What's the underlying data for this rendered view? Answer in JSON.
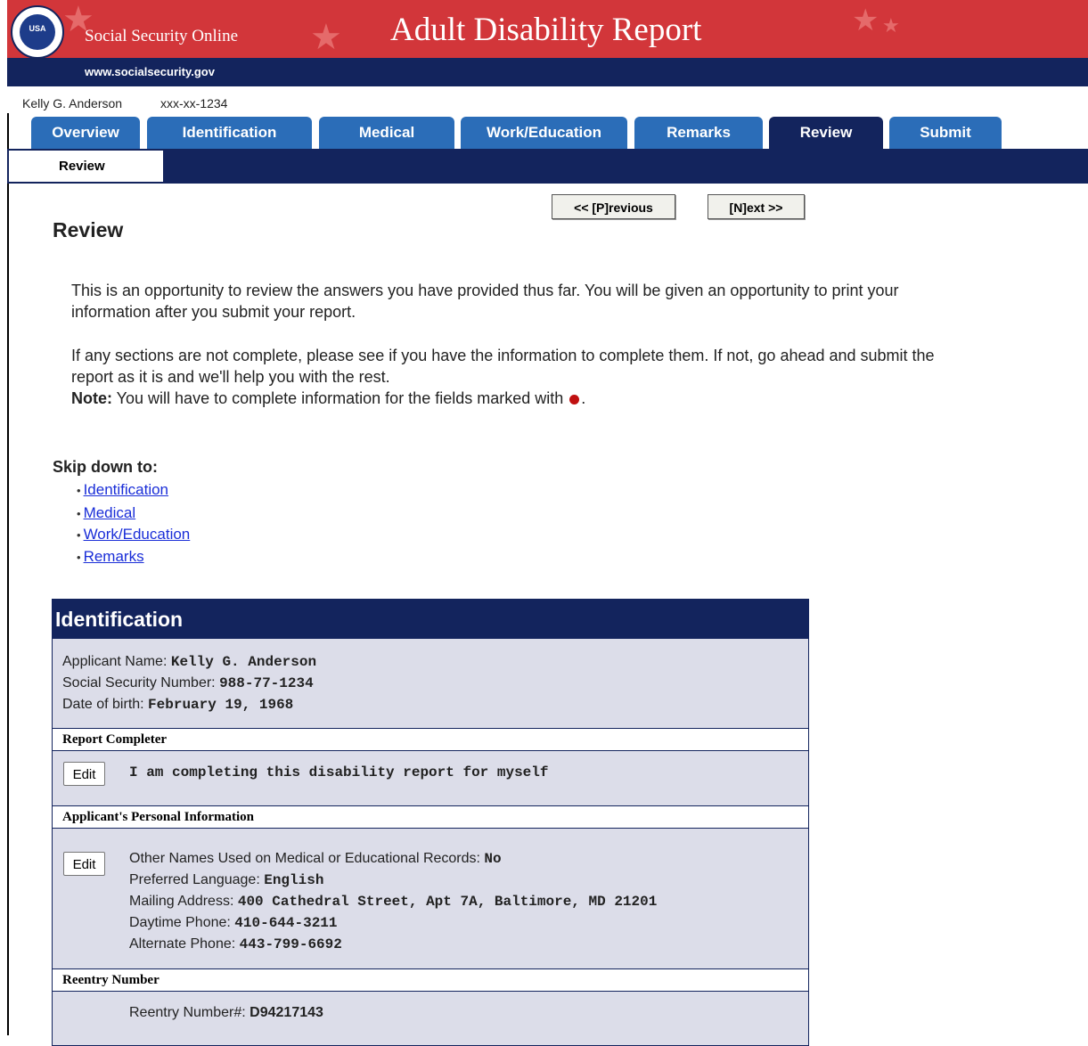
{
  "banner": {
    "seal_text": "USA",
    "brand": "Social Security Online",
    "site": "www.socialsecurity.gov",
    "title": "Adult Disability Report"
  },
  "user": {
    "name": "Kelly G. Anderson",
    "ssn": "xxx-xx-1234"
  },
  "tabs": [
    {
      "label": "Overview"
    },
    {
      "label": "Identification"
    },
    {
      "label": "Medical"
    },
    {
      "label": "Work/Education"
    },
    {
      "label": "Remarks"
    },
    {
      "label": "Review"
    },
    {
      "label": "Submit"
    }
  ],
  "active_tab": "Review",
  "subnav": {
    "active": "Review"
  },
  "nav": {
    "previous": "<< [P]revious",
    "next": "[N]ext >>"
  },
  "page": {
    "heading": "Review",
    "intro1": "This is an opportunity to review the answers you have provided thus far. You will be given an opportunity to print your information after you submit your report.",
    "intro2": "If any sections are not complete, please see if you have the information to complete them. If not, go ahead and submit the report as it is and we'll help you with the rest.",
    "note_label": "Note:",
    "note_text": " You will have to complete information for the fields marked with ",
    "note_end": "."
  },
  "skip": {
    "heading": "Skip down to:",
    "links": [
      "Identification",
      "Medical",
      "Work/Education",
      "Remarks"
    ]
  },
  "identification": {
    "title": "Identification",
    "applicant_name_label": "Applicant Name: ",
    "applicant_name": "Kelly G. Anderson",
    "ssn_label": "Social Security Number: ",
    "ssn": "988-77-1234",
    "dob_label": "Date of birth: ",
    "dob": "February 19, 1968",
    "report_completer": {
      "title": "Report Completer",
      "edit": "Edit",
      "value": "I am completing this disability report for myself"
    },
    "personal_info": {
      "title": "Applicant's Personal Information",
      "edit": "Edit",
      "other_names_label": "Other Names Used on Medical or Educational Records: ",
      "other_names": "No",
      "language_label": "Preferred Language: ",
      "language": "English",
      "address_label": "Mailing Address: ",
      "address": "400 Cathedral Street, Apt 7A, Baltimore, MD 21201",
      "day_phone_label": "Daytime Phone: ",
      "day_phone": "410-644-3211",
      "alt_phone_label": "Alternate Phone: ",
      "alt_phone": "443-799-6692"
    },
    "reentry": {
      "title": "Reentry Number",
      "label": "Reentry Number#: ",
      "value": "D94217143"
    }
  },
  "colors": {
    "banner_red": "#d2363a",
    "navy": "#13245d",
    "tab_blue": "#2b6db8",
    "section_bg": "#dcdde9",
    "link": "#1a2ed8",
    "required_dot": "#c01010"
  }
}
